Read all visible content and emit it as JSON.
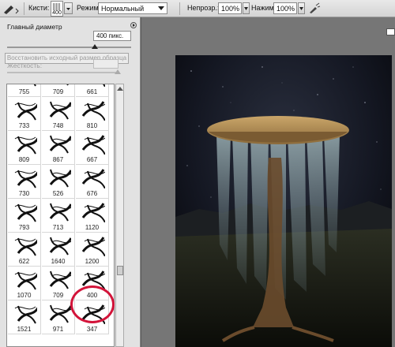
{
  "options_bar": {
    "brushes_label": "Кисти:",
    "brush_size": "400",
    "mode_label": "Режим:",
    "mode_value": "Нормальный",
    "opacity_label": "Непрозр.:",
    "opacity_value": "100%",
    "pressure_label": "Нажим:",
    "pressure_value": "100%"
  },
  "brush_panel": {
    "master_diameter_label": "Главный диаметр",
    "size_value": "400 пикс.",
    "restore_label": "Восстановить исходный размер образца",
    "hardness_label": "Жесткость:",
    "brushes": [
      {
        "num": "755"
      },
      {
        "num": "709"
      },
      {
        "num": "661"
      },
      {
        "num": "733"
      },
      {
        "num": "748"
      },
      {
        "num": "810"
      },
      {
        "num": "809"
      },
      {
        "num": "867"
      },
      {
        "num": "667"
      },
      {
        "num": "730"
      },
      {
        "num": "526"
      },
      {
        "num": "676"
      },
      {
        "num": "793"
      },
      {
        "num": "713"
      },
      {
        "num": "1120"
      },
      {
        "num": "622"
      },
      {
        "num": "1640"
      },
      {
        "num": "1200"
      },
      {
        "num": "1070"
      },
      {
        "num": "709"
      },
      {
        "num": "400"
      },
      {
        "num": "1521"
      },
      {
        "num": "971"
      },
      {
        "num": "347"
      }
    ],
    "selected_brush": "400"
  },
  "colors": {
    "highlight_circle": "#d3143a",
    "canvas_bg": "#0d1018"
  }
}
